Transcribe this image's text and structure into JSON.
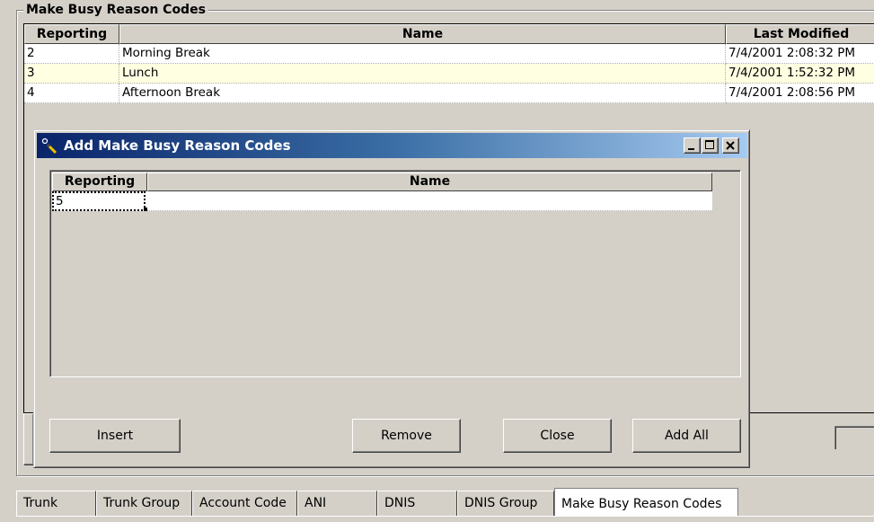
{
  "group": {
    "title": "Make Busy Reason Codes"
  },
  "table": {
    "columns": [
      "Reporting",
      "Name",
      "Last Modified"
    ],
    "rows": [
      {
        "reporting": "2",
        "name": "Morning Break",
        "modified": "7/4/2001 2:08:32 PM"
      },
      {
        "reporting": "3",
        "name": "Lunch",
        "modified": "7/4/2001 1:52:32 PM"
      },
      {
        "reporting": "4",
        "name": "Afternoon Break",
        "modified": "7/4/2001 2:08:56 PM"
      }
    ]
  },
  "dialog": {
    "title": "Add Make Busy Reason Codes",
    "columns": [
      "Reporting",
      "Name"
    ],
    "row": {
      "reporting": "5",
      "name": ""
    },
    "buttons": {
      "insert": "Insert",
      "remove": "Remove",
      "close": "Close",
      "add_all": "Add All"
    }
  },
  "tabs_row1": [
    "Trunk",
    "Trunk Group",
    "Account Code",
    "ANI",
    "DNIS",
    "DNIS Group",
    "Make Busy Reason Codes"
  ],
  "colors": {
    "title_start": "#0a246a",
    "title_end": "#a6caf0",
    "selected_row": "#ffffe1",
    "face": "#d4d0c8"
  },
  "icons": [
    "add-record-icon",
    "minimize-icon",
    "maximize-icon",
    "close-icon"
  ]
}
